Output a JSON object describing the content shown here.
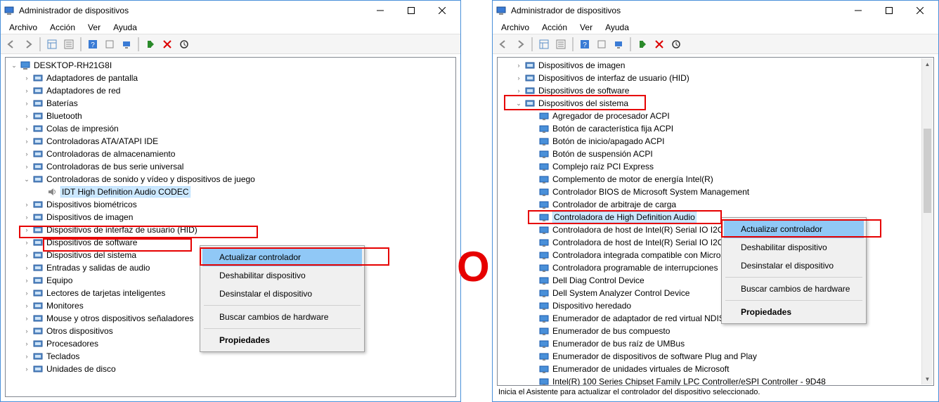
{
  "windows": {
    "left": {
      "title": "Administrador de dispositivos",
      "menus": {
        "archivo": "Archivo",
        "accion": "Acción",
        "ver": "Ver",
        "ayuda": "Ayuda"
      },
      "root": "DESKTOP-RH21G8I",
      "categories": [
        "Adaptadores de pantalla",
        "Adaptadores de red",
        "Baterías",
        "Bluetooth",
        "Colas de impresión",
        "Controladoras ATA/ATAPI IDE",
        "Controladoras de almacenamiento",
        "Controladoras de bus serie universal",
        "Controladoras de sonido y vídeo y dispositivos de juego",
        "Dispositivos biométricos",
        "Dispositivos de imagen",
        "Dispositivos de interfaz de usuario (HID)",
        "Dispositivos de software",
        "Dispositivos del sistema",
        "Entradas y salidas de audio",
        "Equipo",
        "Lectores de tarjetas inteligentes",
        "Monitores",
        "Mouse y otros dispositivos señaladores",
        "Otros dispositivos",
        "Procesadores",
        "Teclados",
        "Unidades de disco"
      ],
      "expanded_category_index": 8,
      "expanded_children": [
        "IDT High Definition Audio CODEC"
      ],
      "context_menu": {
        "items": [
          "Actualizar controlador",
          "Deshabilitar dispositivo",
          "Desinstalar el dispositivo",
          "Buscar cambios de hardware",
          "Propiedades"
        ],
        "highlighted_index": 0,
        "bold_index": 4
      }
    },
    "right": {
      "title": "Administrador de dispositivos",
      "menus": {
        "archivo": "Archivo",
        "accion": "Acción",
        "ver": "Ver",
        "ayuda": "Ayuda"
      },
      "visible_top_categories": [
        "Dispositivos de imagen",
        "Dispositivos de interfaz de usuario (HID)",
        "Dispositivos de software"
      ],
      "expanded_category": "Dispositivos del sistema",
      "expanded_children": [
        "Agregador de procesador ACPI",
        "Botón de característica fija ACPI",
        "Botón de inicio/apagado ACPI",
        "Botón de suspensión ACPI",
        "Complejo raíz PCI Express",
        "Complemento de motor de energía Intel(R)",
        "Controlador BIOS de Microsoft System Management",
        "Controlador de arbitraje de carga",
        "Controladora de High Definition Audio",
        "Controladora de host de Intel(R) Serial IO I2C - 9D60",
        "Controladora de host de Intel(R) Serial IO I2C - 9D61",
        "Controladora integrada compatible con Microsoft ACPI",
        "Controladora programable de interrupciones",
        "Dell Diag Control Device",
        "Dell System Analyzer Control Device",
        "Dispositivo heredado",
        "Enumerador de adaptador de red virtual NDIS",
        "Enumerador de bus compuesto",
        "Enumerador de bus raíz de UMBus",
        "Enumerador de dispositivos de software Plug and Play",
        "Enumerador de unidades virtuales de Microsoft",
        "Intel(R) 100 Series Chipset Family LPC Controller/eSPI Controller - 9D48"
      ],
      "selected_child_index": 8,
      "context_menu": {
        "items": [
          "Actualizar controlador",
          "Deshabilitar dispositivo",
          "Desinstalar el dispositivo",
          "Buscar cambios de hardware",
          "Propiedades"
        ],
        "highlighted_index": 0,
        "bold_index": 4
      },
      "statusbar": "Inicia el Asistente para actualizar el controlador del dispositivo seleccionado."
    }
  },
  "annotations": {
    "divider": "O"
  },
  "colors": {
    "highlight_red": "#e60000",
    "selection_blue": "#cce8ff",
    "menu_hover": "#90c8f6"
  }
}
